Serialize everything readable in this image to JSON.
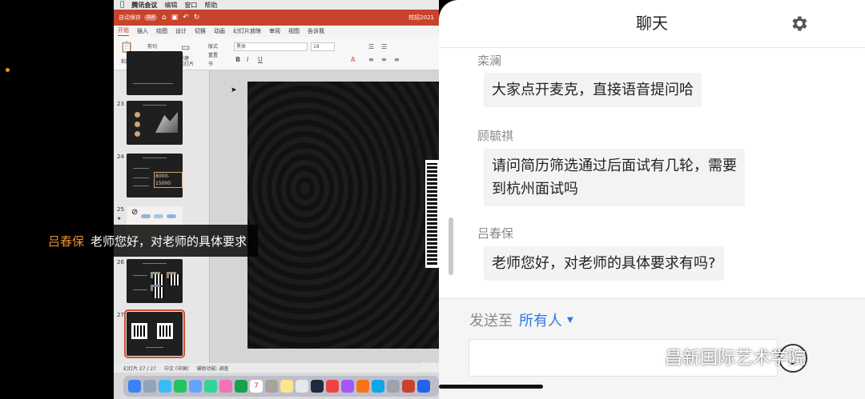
{
  "mac_menubar": {
    "app": "腾讯会议",
    "items": [
      "编辑",
      "窗口",
      "帮助"
    ]
  },
  "ppt": {
    "autosave_label": "自动保存",
    "autosave_state": "关闭",
    "doc_title": "校招2021",
    "tabs": [
      "开始",
      "插入",
      "绘图",
      "设计",
      "切换",
      "动画",
      "幻灯片放映",
      "审阅",
      "视图",
      "告诉我"
    ],
    "ribbon": {
      "paste": "粘贴",
      "cut": "剪切",
      "copy": "复制",
      "format": "格式",
      "new_slide": "新建\n幻灯片",
      "layout": "版式",
      "reset": "重置",
      "section": "节",
      "font": "黑体",
      "font_size": "18"
    },
    "thumbnails": [
      {
        "number": "23"
      },
      {
        "number": "24",
        "salary": "8000-15000"
      },
      {
        "number": "25"
      },
      {
        "number": "26"
      },
      {
        "number": "27"
      }
    ],
    "status": {
      "slide_pos": "幻灯片 27 / 27",
      "language": "中文 (中国)",
      "accessibility": "辅助功能: 调查"
    },
    "slide_counter": "1/15"
  },
  "subtitle": {
    "speaker": "吕春保",
    "text": "老师您好，对老师的具体要求"
  },
  "chat": {
    "title": "聊天",
    "messages": [
      {
        "name": "栾澜",
        "lines": [
          "大家点开麦克，直接语音提问哈"
        ]
      },
      {
        "name": "顾毓祺",
        "lines": [
          "请问简历筛选通过后面试有几轮，需要",
          "到杭州面试吗"
        ]
      },
      {
        "name": "吕春保",
        "lines": [
          "老师您好，对老师的具体要求有吗?"
        ]
      }
    ],
    "send_to_label": "发送至",
    "send_to_target": "所有人",
    "input_value": ""
  },
  "watermark": {
    "text": "昌新国际艺术学院"
  },
  "colors": {
    "accent": "#2b79e8",
    "ppt_red": "#c7432d",
    "speaker": "#e8902a"
  }
}
